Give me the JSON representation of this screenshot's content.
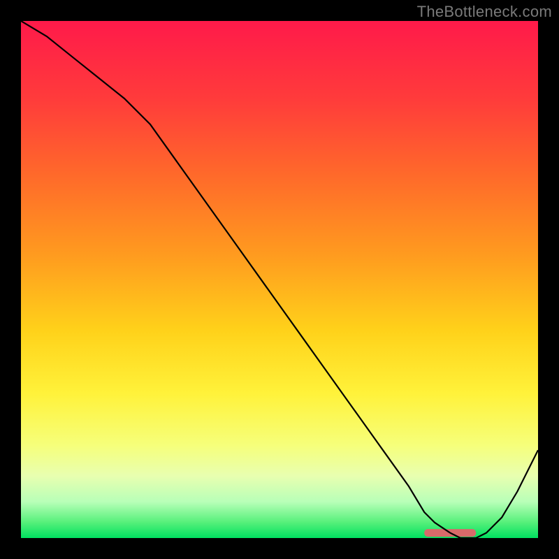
{
  "watermark": "TheBottleneck.com",
  "chart_data": {
    "type": "line",
    "title": "",
    "xlabel": "",
    "ylabel": "",
    "xlim": [
      0,
      100
    ],
    "ylim": [
      0,
      100
    ],
    "x": [
      0,
      5,
      10,
      15,
      20,
      25,
      30,
      35,
      40,
      45,
      50,
      55,
      60,
      65,
      70,
      75,
      78,
      80,
      83,
      85,
      88,
      90,
      93,
      96,
      100
    ],
    "values": [
      100,
      97,
      93,
      89,
      85,
      80,
      73,
      66,
      59,
      52,
      45,
      38,
      31,
      24,
      17,
      10,
      5,
      3,
      1,
      0,
      0,
      1,
      4,
      9,
      17
    ],
    "marker": {
      "x_start": 78,
      "x_end": 88,
      "y": 1.0,
      "color": "#d86a6a"
    },
    "gradient_stops": [
      {
        "offset": 0.0,
        "color": "#ff1a4a"
      },
      {
        "offset": 0.15,
        "color": "#ff3b3b"
      },
      {
        "offset": 0.3,
        "color": "#ff6a2a"
      },
      {
        "offset": 0.45,
        "color": "#ff9a1f"
      },
      {
        "offset": 0.6,
        "color": "#ffd21a"
      },
      {
        "offset": 0.72,
        "color": "#fff23a"
      },
      {
        "offset": 0.82,
        "color": "#f6ff7a"
      },
      {
        "offset": 0.88,
        "color": "#e8ffb0"
      },
      {
        "offset": 0.93,
        "color": "#b8ffb8"
      },
      {
        "offset": 0.97,
        "color": "#55f07a"
      },
      {
        "offset": 1.0,
        "color": "#00e060"
      }
    ]
  }
}
